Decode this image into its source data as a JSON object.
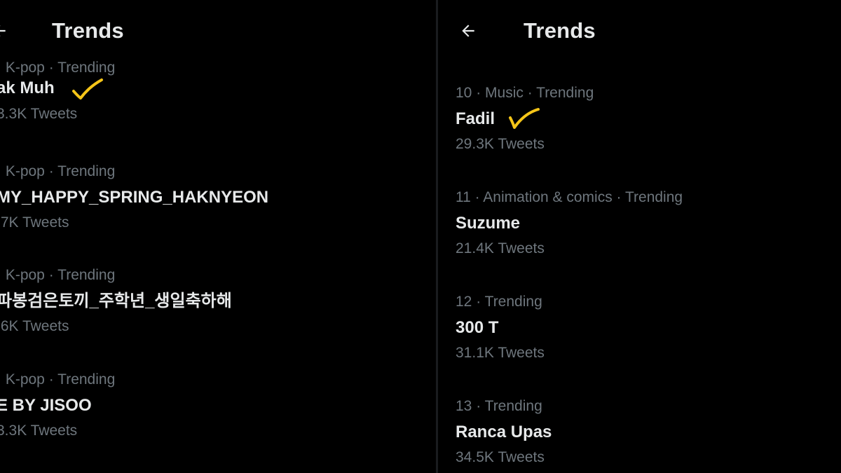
{
  "left": {
    "title": "Trends",
    "items": [
      {
        "meta": "· K-pop · Trending",
        "name": "ak Muh",
        "count": "3.3K Tweets",
        "checked": true
      },
      {
        "meta": "· K-pop · Trending",
        "name": "MY_HAPPY_SPRING_HAKNYEON",
        "count": ".7K Tweets",
        "checked": false
      },
      {
        "meta": "· K-pop · Trending",
        "name": "파봉검은토끼_주학년_생일축하해",
        "count": ".6K Tweets",
        "checked": false
      },
      {
        "meta": "· K-pop · Trending",
        "name": "E BY JISOO",
        "count": "3.3K Tweets",
        "checked": false
      }
    ]
  },
  "right": {
    "title": "Trends",
    "items": [
      {
        "meta": "10 · Music · Trending",
        "name": "Fadil",
        "count": "29.3K Tweets",
        "checked": true
      },
      {
        "meta": "11 · Animation & comics · Trending",
        "name": "Suzume",
        "count": "21.4K Tweets",
        "checked": false
      },
      {
        "meta": "12 · Trending",
        "name": "300 T",
        "count": "31.1K Tweets",
        "checked": false
      },
      {
        "meta": "13 · Trending",
        "name": "Ranca Upas",
        "count": "34.5K Tweets",
        "checked": false
      }
    ]
  },
  "icons": {
    "back": "back-arrow-icon",
    "check": "checkmark-annotation-icon"
  },
  "colors": {
    "background": "#000000",
    "primary_text": "#e7e9ea",
    "secondary_text": "#6e767d",
    "annotation": "#f5c518"
  }
}
